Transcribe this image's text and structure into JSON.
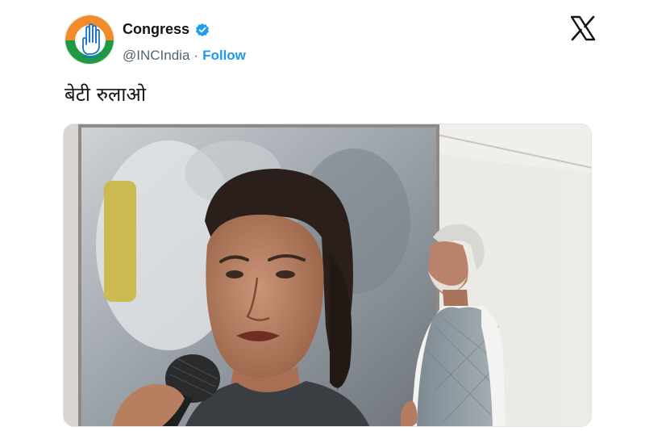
{
  "author": {
    "display_name": "Congress",
    "handle": "@INCIndia",
    "separator": "·",
    "follow_label": "Follow",
    "verified_badge_color": "#1d9bf0",
    "avatar_icon": "congress-hand-logo-icon"
  },
  "platform": {
    "logo_icon": "x-logo-icon"
  },
  "tweet": {
    "text": "बेटी रुलाओ"
  },
  "media": {
    "description_icon": "photo-icon"
  },
  "colors": {
    "saffron": "#f18b2b",
    "green": "#1e9a44",
    "link_blue": "#1d9bf0",
    "muted": "#536471"
  }
}
